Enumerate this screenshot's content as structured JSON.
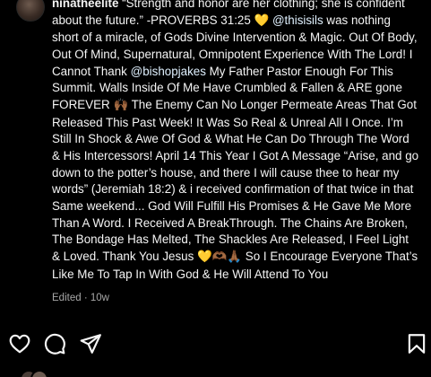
{
  "post": {
    "username": "ninatheelite",
    "caption_intro": "“Strength and honor are her clothing; she is confident about the future.” -PROVERBS 31:25 ",
    "heart_emoji": "💛",
    "mention_1": "@thisisils",
    "caption_part_1": " was nothing short of a miracle, of Gods Divine Intervention & Magic. Out Of Body, Out Of Mind, Supernatural, Omnipotent Experience With The Lord! I Cannot Thank ",
    "mention_2": "@bishopjakes",
    "caption_part_2": " My Father Pastor Enough For This Summit. Walls Inside Of Me Have Crumbled & Fallen & ARE gone FOREVER ",
    "raised_hands_emoji": "🙌🏾",
    "caption_part_3": " The Enemy Can No Longer Permeate Areas That Got Released This Past Week! It Was So Real & Unreal All I Once. I’m Still In Shock & Awe Of God & What He Can Do Through The Word & His Intercessors! April 14 This Year I Got A Message “Arise, and go down to the potter’s house, and there I will cause thee to hear my words” (Jeremiah 18:2) & i received confirmation of that twice in that Same weekend... God Will Fulfill His Promises & He Gave Me More Than A Word. I Received A BreakThrough. The Chains Are Broken, The Bondage Has Melted, The Shackles Are Released, I Feel Light & Loved. Thank You Jesus ",
    "closing_emojis": "💛🫶🏾🙏🏾",
    "caption_part_4": " So I Encourage Everyone That’s Like Me To Tap In With God & He Will Attend To You",
    "edited_label": "Edited",
    "separator": "·",
    "age": "10w"
  },
  "actions": {
    "like_icon": "heart-outline-icon",
    "comment_icon": "comment-bubble-icon",
    "share_icon": "paper-plane-icon",
    "save_icon": "bookmark-icon"
  },
  "colors": {
    "background": "#000000",
    "text": "#f5f5f5",
    "secondary_text": "#a8a8a8",
    "mention": "#e0f1ff"
  }
}
